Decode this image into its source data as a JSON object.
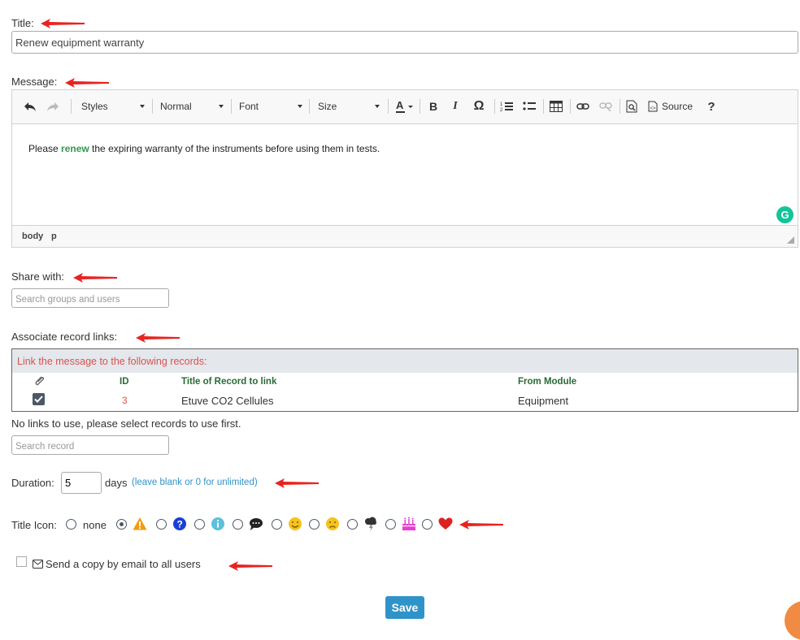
{
  "title_field": {
    "label": "Title:",
    "value": "Renew equipment warranty"
  },
  "message": {
    "label": "Message:",
    "toolbar": {
      "styles": "Styles",
      "format": "Normal",
      "font": "Font",
      "size": "Size",
      "source": "Source"
    },
    "body": {
      "pre": "Please ",
      "highlight": "renew",
      "post": " the expiring warranty of the instruments before using them in tests."
    },
    "status": [
      "body",
      "p"
    ]
  },
  "share": {
    "label": "Share with:",
    "placeholder": "Search groups and users"
  },
  "records": {
    "label": "Associate record links:",
    "heading": "Link the message to the following records:",
    "columns": {
      "id": "ID",
      "title": "Title of Record to link",
      "module": "From Module"
    },
    "rows": [
      {
        "id": "3",
        "title": "Etuve CO2 Cellules",
        "module": "Equipment"
      }
    ],
    "note": "No links to use, please select records to use first.",
    "search_placeholder": "Search record"
  },
  "duration": {
    "label": "Duration:",
    "value": "5",
    "unit": "days",
    "hint": "(leave blank or 0 for unlimited)"
  },
  "title_icon": {
    "label": "Title Icon:",
    "none_label": "none",
    "selected": "warning",
    "options": [
      "none",
      "warning",
      "question",
      "info",
      "speech",
      "smile",
      "sad",
      "cloud",
      "cake",
      "heart"
    ]
  },
  "email_copy": {
    "label": "Send a copy by email to all users",
    "checked": false
  },
  "save_label": "Save",
  "colors": {
    "accent": "#2f93c9",
    "arrow": "#e8231f",
    "link_green": "#2e9a4e",
    "heading_red": "#d9534f"
  }
}
